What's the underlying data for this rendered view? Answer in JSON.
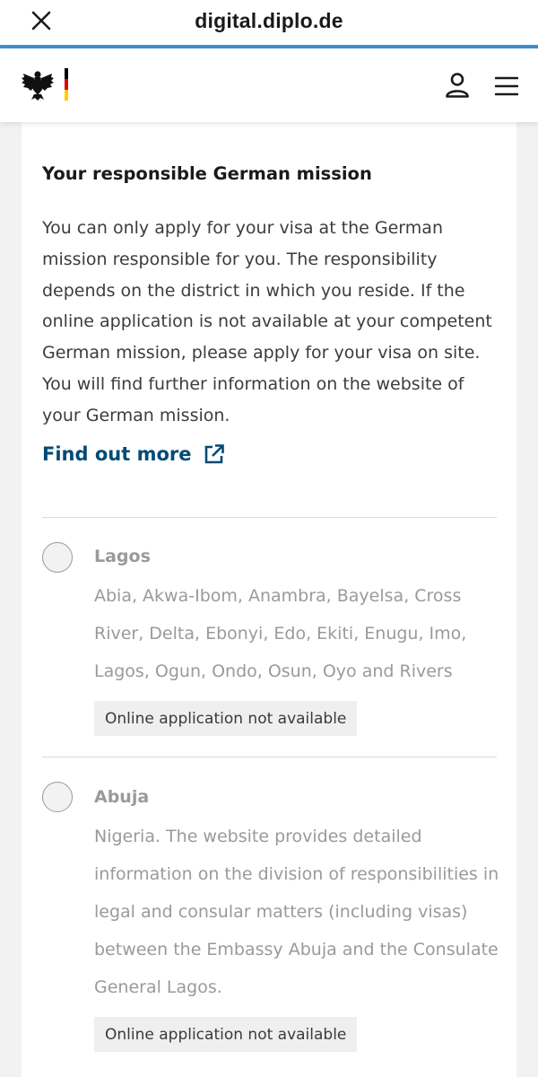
{
  "browser": {
    "url": "digital.diplo.de",
    "close_icon": "close-icon",
    "accent_color": "#3d8fd3"
  },
  "header": {
    "logo_icon": "federal-eagle-icon",
    "user_icon": "user-icon",
    "menu_icon": "hamburger-menu-icon"
  },
  "content": {
    "title": "Your responsible German mission",
    "intro_lines": [
      "You can only apply for your visa at the German",
      "mission responsible for you. The responsibility",
      "depends on the district in which you reside. If the",
      "online application is not available at your competent",
      "German mission, please apply for your visa on site.",
      "You will find further information on the website of",
      "your German mission."
    ],
    "find_out_more": "Find out more",
    "find_out_more_icon": "external-link-icon",
    "link_color": "#004b76"
  },
  "missions": [
    {
      "name": "Lagos",
      "desc_lines": [
        "Abia, Akwa-Ibom, Anambra, Bayelsa, Cross",
        "River, Delta, Ebonyi, Edo, Ekiti, Enugu, Imo,",
        "Lagos, Ogun, Ondo, Osun, Oyo and Rivers"
      ],
      "badge": "Online application not available",
      "selected": false
    },
    {
      "name": "Abuja",
      "desc_lines": [
        "Nigeria. The website provides detailed",
        "information on the division of responsibilities in",
        "legal and consular matters (including visas)",
        "between the Embassy Abuja and the Consulate",
        "General Lagos."
      ],
      "badge": "Online application not available",
      "selected": false
    }
  ]
}
